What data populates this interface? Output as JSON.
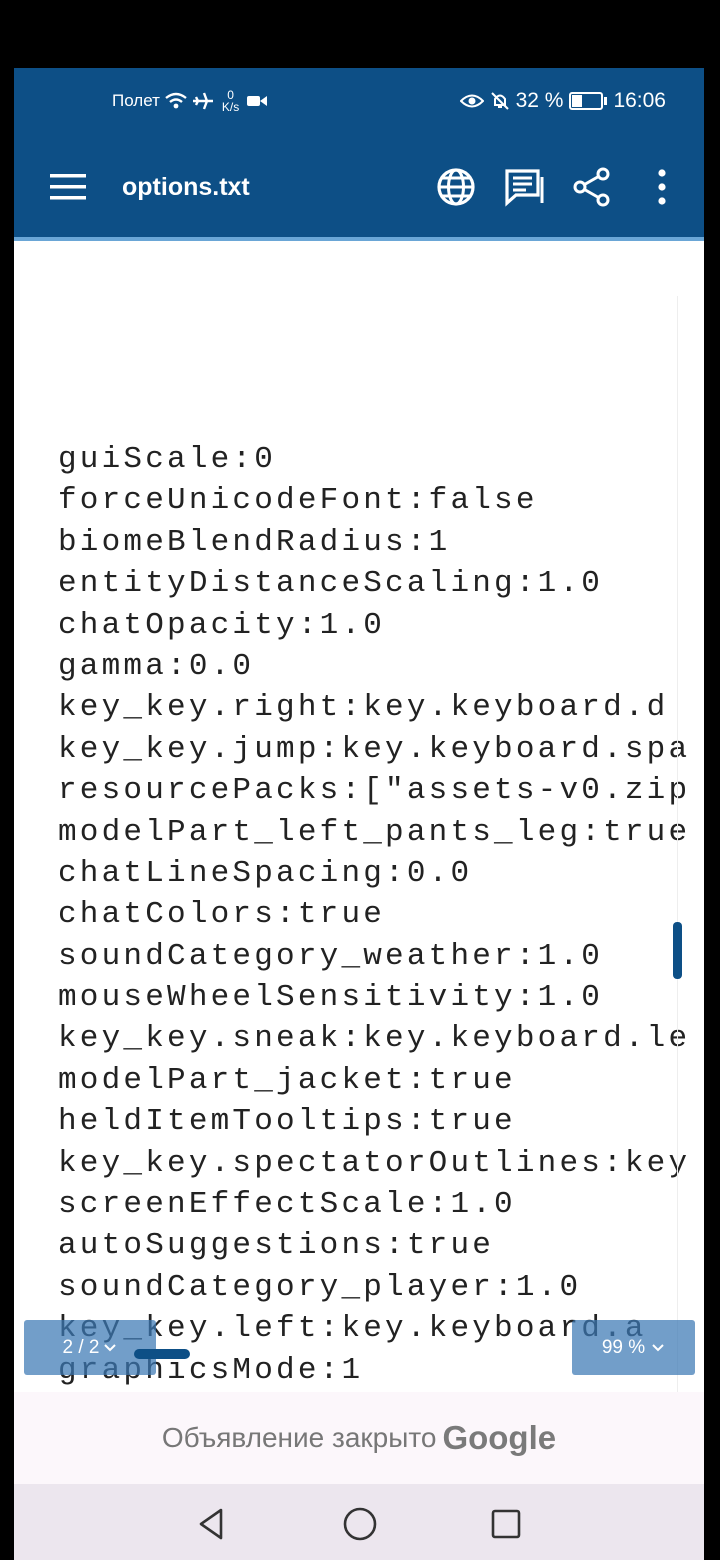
{
  "status_bar": {
    "airplane_label": "Полет",
    "net_speed_value": "0",
    "net_speed_unit": "K/s",
    "battery": "32 %",
    "time": "16:06",
    "icons": [
      "wifi-icon",
      "airplane-icon",
      "camera-icon",
      "eye-icon",
      "bell-off-icon",
      "battery-icon"
    ]
  },
  "app_bar": {
    "title": "options.txt",
    "icons": [
      "menu-icon",
      "globe-icon",
      "reader-icon",
      "share-icon",
      "more-vert-icon"
    ]
  },
  "content": {
    "lines": [
      "guiScale:0",
      "forceUnicodeFont:false",
      "biomeBlendRadius:1",
      "entityDistanceScaling:1.0",
      "chatOpacity:1.0",
      "gamma:0.0",
      "key_key.right:key.keyboard.d",
      "key_key.jump:key.keyboard.spa",
      "resourcePacks:[\"assets-v0.zip",
      "modelPart_left_pants_leg:true",
      "chatLineSpacing:0.0",
      "chatColors:true",
      "soundCategory_weather:1.0",
      "mouseWheelSensitivity:1.0",
      "key_key.sneak:key.keyboard.le",
      "modelPart_jacket:true",
      "heldItemTooltips:true",
      "key_key.spectatorOutlines:key",
      "screenEffectScale:1.0",
      "autoSuggestions:true",
      "soundCategory_player:1.0",
      "key_key.left:key.keyboard.a",
      "graphicsMode:1"
    ]
  },
  "page_indicator": {
    "label": "2 / 2",
    "icon": "chevron-down-icon"
  },
  "zoom_indicator": {
    "label": "99 %",
    "icon": "chevron-down-icon"
  },
  "ad_banner": {
    "text": "Объявление закрыто",
    "brand": "Google"
  },
  "nav_bar": {
    "icons": [
      "back-icon",
      "home-icon",
      "recent-apps-icon"
    ]
  },
  "colors": {
    "primary": "#0d4f86",
    "background": "#ffffff"
  }
}
